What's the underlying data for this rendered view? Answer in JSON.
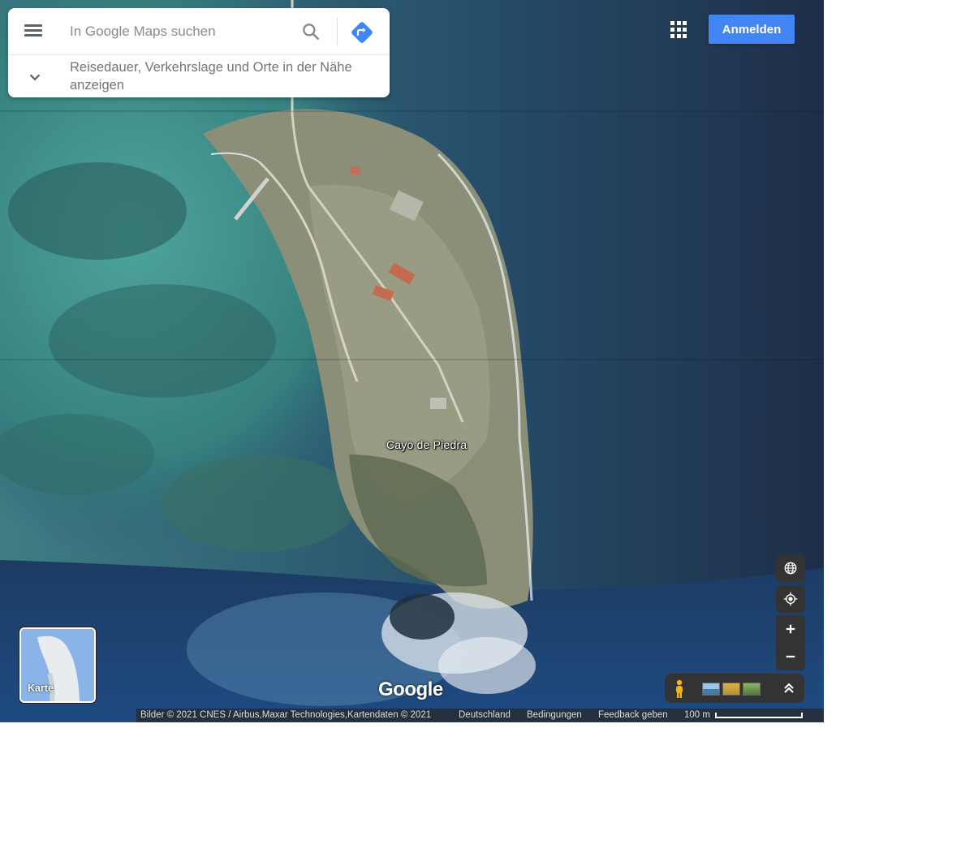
{
  "search": {
    "placeholder": "In Google Maps suchen",
    "expand_text": "Reisedauer, Verkehrslage und Orte in der Nähe anzeigen"
  },
  "header": {
    "signin_label": "Anmelden"
  },
  "map": {
    "view": "satellite",
    "place_label": "Cayo de Piedra",
    "logo_text": "Google"
  },
  "layer_switcher": {
    "label": "Karte"
  },
  "footer": {
    "attribution": "Bilder © 2021 CNES / Airbus,Maxar Technologies,Kartendaten © 2021",
    "country": "Deutschland",
    "terms": "Bedingungen",
    "feedback": "Feedback geben",
    "scale": "100 m"
  },
  "icons": [
    "menu-icon",
    "search-icon",
    "directions-icon",
    "chevron-down-icon",
    "apps-grid-icon",
    "globe-icon",
    "my-location-icon",
    "zoom-in-icon",
    "zoom-out-icon",
    "pegman-icon",
    "chevron-up-icon"
  ],
  "colors": {
    "accent": "#4285f4",
    "control_bg": "#333333"
  }
}
